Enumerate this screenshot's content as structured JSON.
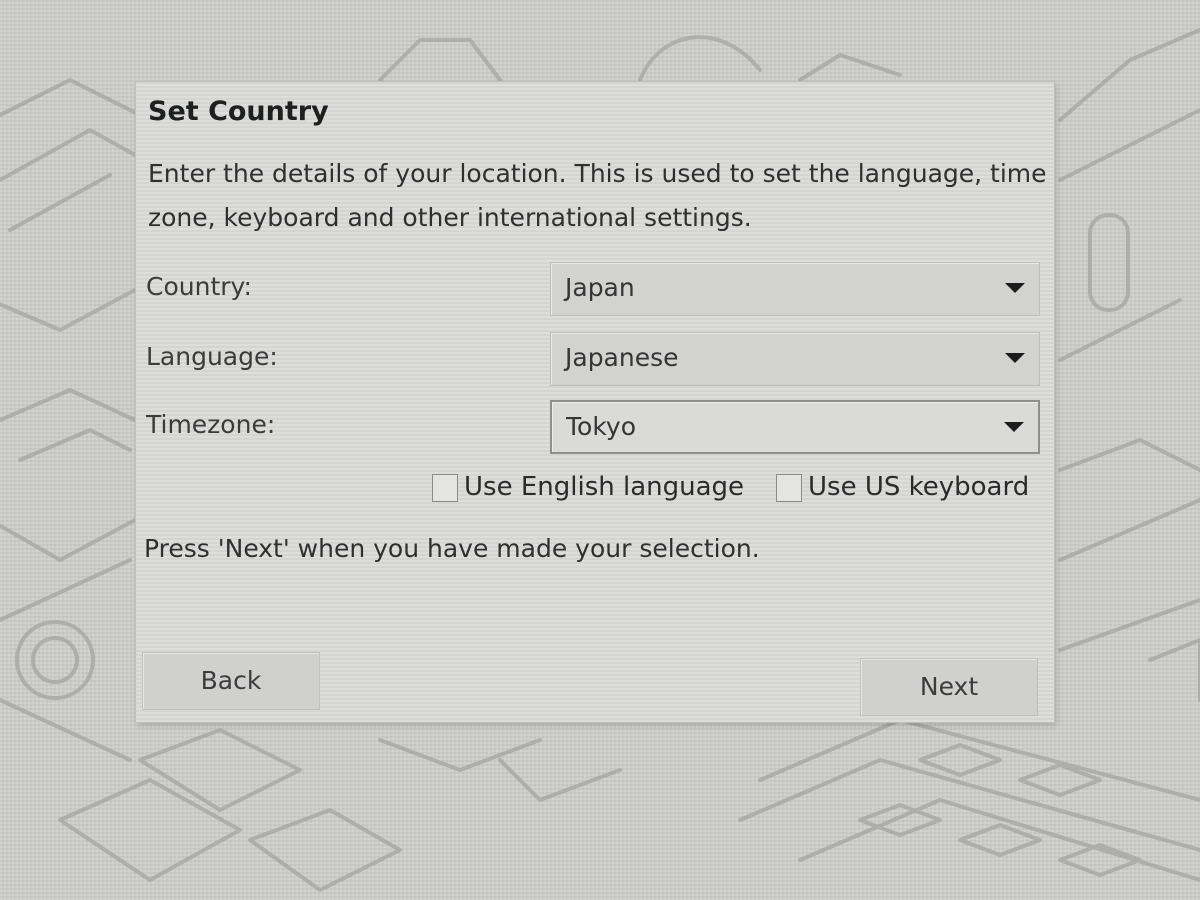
{
  "dialog": {
    "title": "Set Country",
    "description": "Enter the details of your location. This is used to set the language, time zone, keyboard and other international settings.",
    "fields": {
      "country": {
        "label": "Country:",
        "value": "Japan"
      },
      "language": {
        "label": "Language:",
        "value": "Japanese"
      },
      "timezone": {
        "label": "Timezone:",
        "value": "Tokyo"
      }
    },
    "checkboxes": {
      "english": {
        "label": "Use English language",
        "checked": false
      },
      "us_keyboard": {
        "label": "Use US keyboard",
        "checked": false
      }
    },
    "hint": "Press 'Next' when you have made your selection.",
    "buttons": {
      "back": "Back",
      "next": "Next"
    }
  },
  "icons": {
    "dropdown": "chevron-down-icon"
  }
}
